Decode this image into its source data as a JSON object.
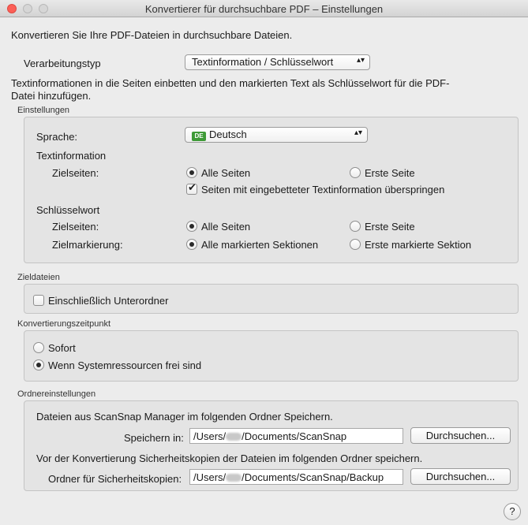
{
  "window": {
    "title": "Konvertierer für durchsuchbare PDF – Einstellungen"
  },
  "intro": "Konvertieren Sie Ihre PDF-Dateien in durchsuchbare Dateien.",
  "processing": {
    "label": "Verarbeitungstyp",
    "value": "Textinformation / Schlüsselwort",
    "description_line1": "Textinformationen in die Seiten einbetten und den markierten Text als Schlüsselwort für die PDF-",
    "description_line2": "Datei hinzufügen."
  },
  "settings": {
    "group_label": "Einstellungen",
    "language_label": "Sprache:",
    "language_flag": "DE",
    "language_value": "Deutsch",
    "textinfo_heading": "Textinformation",
    "textinfo_target_label": "Zielseiten:",
    "textinfo_all_pages": "Alle Seiten",
    "textinfo_first_page": "Erste Seite",
    "skip_embedded_label": "Seiten mit eingebetteter Textinformation überspringen",
    "keyword_heading": "Schlüsselwort",
    "keyword_target_label": "Zielseiten:",
    "keyword_all_pages": "Alle Seiten",
    "keyword_first_page": "Erste Seite",
    "marking_label": "Zielmarkierung:",
    "marking_all": "Alle markierten Sektionen",
    "marking_first": "Erste markierte Sektion"
  },
  "target_files": {
    "group_label": "Zieldateien",
    "subfolders_label": "Einschließlich Unterordner"
  },
  "timing": {
    "group_label": "Konvertierungszeitpunkt",
    "immediate_label": "Sofort",
    "idle_label": "Wenn Systemressourcen frei sind"
  },
  "folders": {
    "group_label": "Ordnereinstellungen",
    "save_description": "Dateien aus ScanSnap Manager im folgenden Ordner Speichern.",
    "save_label": "Speichern in:",
    "save_path_prefix": "/Users/",
    "save_path_suffix": "/Documents/ScanSnap",
    "browse_label": "Durchsuchen...",
    "backup_description": "Vor der Konvertierung Sicherheitskopien der Dateien im folgenden Ordner speichern.",
    "backup_label": "Ordner für Sicherheitskopien:",
    "backup_path_prefix": "/Users/",
    "backup_path_suffix": "/Documents/ScanSnap/Backup",
    "backup_browse_label": "Durchsuchen..."
  },
  "help": {
    "label": "?"
  }
}
